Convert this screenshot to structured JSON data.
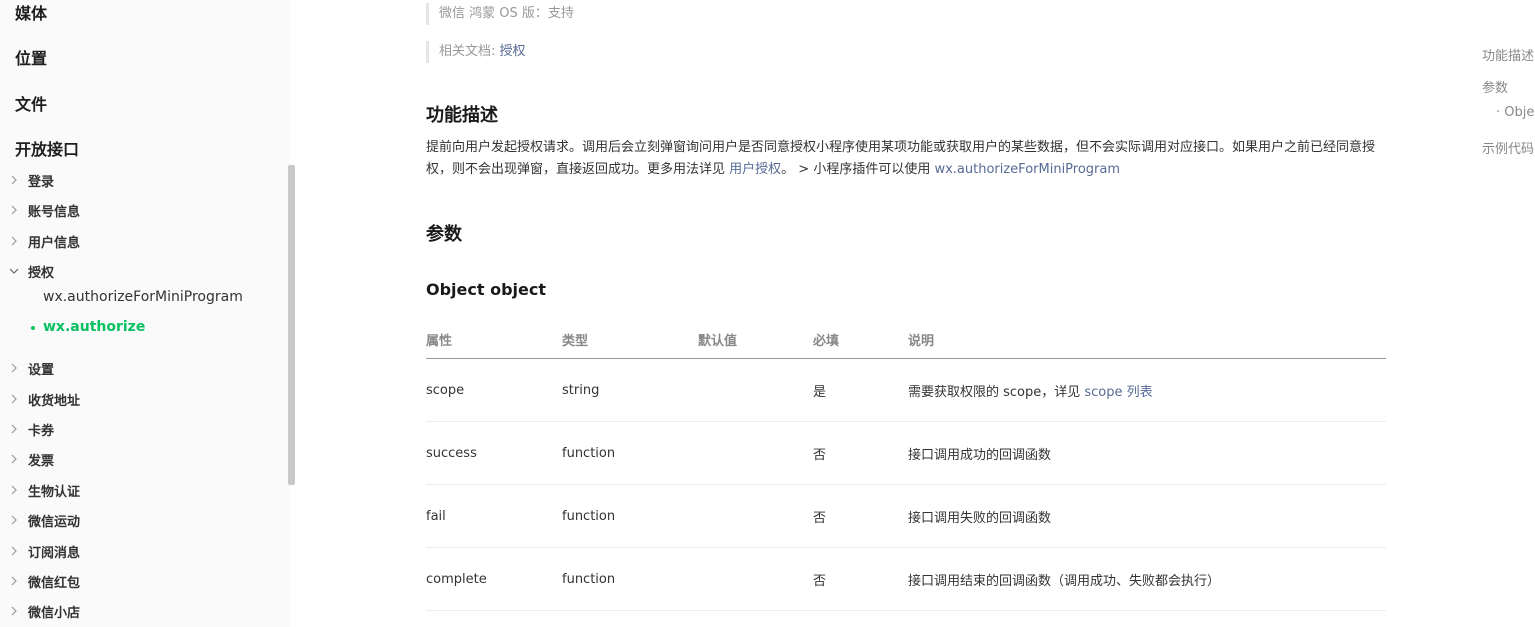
{
  "sidebar": {
    "sections": [
      "媒体",
      "位置",
      "文件",
      "开放接口"
    ],
    "items": [
      {
        "label": "登录",
        "expanded": false
      },
      {
        "label": "账号信息",
        "expanded": false
      },
      {
        "label": "用户信息",
        "expanded": false
      },
      {
        "label": "授权",
        "expanded": true
      },
      {
        "label": "设置",
        "expanded": false
      },
      {
        "label": "收货地址",
        "expanded": false
      },
      {
        "label": "卡券",
        "expanded": false
      },
      {
        "label": "发票",
        "expanded": false
      },
      {
        "label": "生物认证",
        "expanded": false
      },
      {
        "label": "微信运动",
        "expanded": false
      },
      {
        "label": "订阅消息",
        "expanded": false
      },
      {
        "label": "微信红包",
        "expanded": false
      },
      {
        "label": "微信小店",
        "expanded": false
      }
    ],
    "sub_items": [
      {
        "label": "wx.authorizeForMiniProgram",
        "active": false
      },
      {
        "label": "wx.authorize",
        "active": true
      }
    ],
    "active_color": "#07c160"
  },
  "meta": {
    "harmony_label": "微信 鸿蒙 OS 版",
    "harmony_sep": "：",
    "harmony_value": "支持",
    "docs_label": "相关文档: ",
    "docs_link": "授权"
  },
  "content": {
    "h_desc": "功能描述",
    "desc_part1": "提前向用户发起授权请求。调用后会立刻弹窗询问用户是否同意授权小程序使用某项功能或获取用户的某些数据，但不会实际调用对应接口。如果用户之前已经同意授权，则不会出现弹窗，直接返回成功。更多用法详见 ",
    "desc_link1": "用户授权",
    "desc_part2": "。 > 小程序插件可以使用 ",
    "desc_link2": "wx.authorizeForMiniProgram",
    "h_params": "参数",
    "h_object": "Object object",
    "link_color": "#576b95"
  },
  "table": {
    "headers": [
      "属性",
      "类型",
      "默认值",
      "必填",
      "说明"
    ],
    "rows": [
      {
        "name": "scope",
        "type": "string",
        "default": "",
        "required": "是",
        "desc": "需要获取权限的 scope，详见 ",
        "desc_link": "scope 列表"
      },
      {
        "name": "success",
        "type": "function",
        "default": "",
        "required": "否",
        "desc": "接口调用成功的回调函数",
        "desc_link": ""
      },
      {
        "name": "fail",
        "type": "function",
        "default": "",
        "required": "否",
        "desc": "接口调用失败的回调函数",
        "desc_link": ""
      },
      {
        "name": "complete",
        "type": "function",
        "default": "",
        "required": "否",
        "desc": "接口调用结束的回调函数（调用成功、失败都会执行）",
        "desc_link": ""
      }
    ]
  },
  "toc": {
    "items": [
      "功能描述",
      "参数",
      "· Obje",
      "示例代码"
    ]
  }
}
